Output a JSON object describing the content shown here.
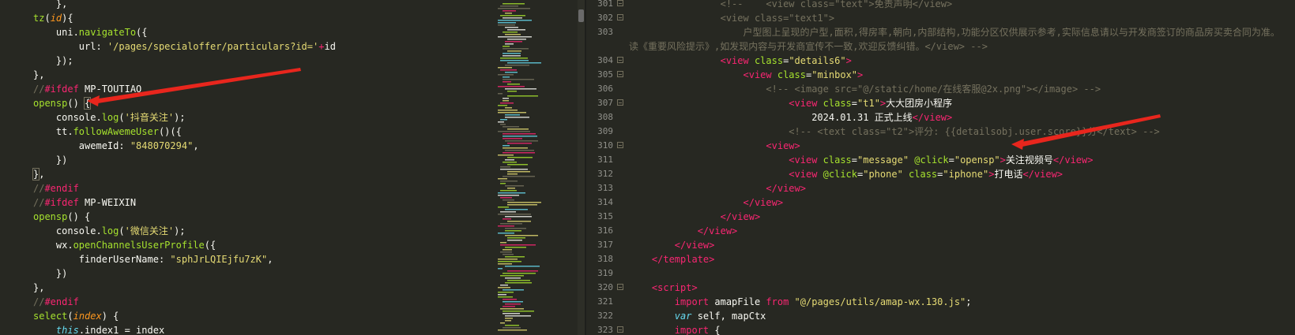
{
  "left_code": [
    "    },",
    "    tz(id){",
    "        uni.navigateTo({",
    "            url: '/pages/specialoffer/particulars?id='+id",
    "        });",
    "    },",
    "    //#ifdef MP-TOUTIAO",
    "    opensp() {",
    "        console.log('抖音关注');",
    "        tt.followAwemeUser()({",
    "            awemeId: \"848070294\",",
    "        })",
    "    },",
    "    //#endif",
    "    //#ifdef MP-WEIXIN",
    "    opensp() {",
    "        console.log('微信关注');",
    "        wx.openChannelsUserProfile({",
    "            finderUserName: \"sphJrLQIEjfu7zK\",",
    "        })",
    "    },",
    "    //#endif",
    "    select(index) {",
    "        this.index1 = index"
  ],
  "right_line_numbers": [
    "301",
    "302",
    "303",
    "",
    "304",
    "305",
    "306",
    "307",
    "308",
    "309",
    "310",
    "311",
    "312",
    "313",
    "314",
    "315",
    "316",
    "317",
    "318",
    "319",
    "320",
    "321",
    "322",
    "323"
  ],
  "right_code": [
    "                <!--    <view class=\"text\">免责声明</view>",
    "                <view class=\"text1\">",
    "                    户型图上呈现的户型,面积,得房率,朝向,内部结构,功能分区仅供展示参考,实际信息请以与开发商签订的商品房买卖合同为准。",
    "读《重要风险提示》,如发现内容与开发商宣传不一致,欢迎反馈纠错。</view> -->",
    "                <view class=\"details6\">",
    "                    <view class=\"minbox\">",
    "                        <!-- <image src=\"@/static/home/在线客服@2x.png\"></image> -->",
    "                            <view class=\"t1\">大大团房小程序",
    "                                2024.01.31 正式上线</view>",
    "                            <!-- <text class=\"t2\">评分: {{detailsobj.user.score}}分</text> -->",
    "                        <view>",
    "                            <view class=\"message\" @click=\"opensp\">关注视频号</view>",
    "                            <view @click=\"phone\" class=\"iphone\">打电话</view>",
    "                        </view>",
    "                    </view>",
    "                </view>",
    "            </view>",
    "        </view>",
    "    </template>",
    "",
    "    <script>",
    "        import amapFile from \"@/pages/utils/amap-wx.130.js\";",
    "        var self, mapCtx",
    "        import {"
  ],
  "colors": {
    "background": "#272822",
    "keyword": "#f92672",
    "function": "#a6e22e",
    "string": "#e6db74",
    "comment": "#75715e",
    "param": "#fd971f",
    "storage": "#66d9ef",
    "arrow": "#e8261d"
  }
}
